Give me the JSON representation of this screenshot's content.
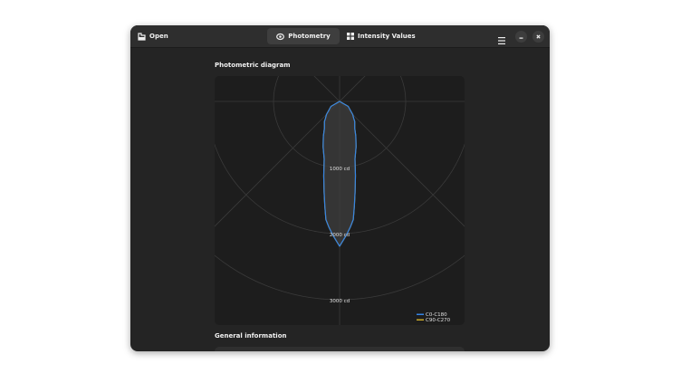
{
  "header": {
    "open_label": "Open",
    "tabs": [
      {
        "label": "Photometry",
        "icon": "eye-icon",
        "active": true
      },
      {
        "label": "Intensity Values",
        "icon": "grid-icon",
        "active": false
      }
    ],
    "menu_icon": "hamburger-icon",
    "minimize_icon": "minimize-icon",
    "close_icon": "close-icon"
  },
  "main": {
    "diagram_title": "Photometric diagram",
    "general_title": "General information"
  },
  "chart_data": {
    "type": "polar",
    "radial_ticks": [
      {
        "value": 1000,
        "label": "1000 cd"
      },
      {
        "value": 2000,
        "label": "2000 cd"
      },
      {
        "value": 3000,
        "label": "3000 cd"
      }
    ],
    "angle_unit": "deg",
    "series": [
      {
        "name": "C0-C180",
        "color": "#3584e4",
        "angles": [
          0,
          3,
          5,
          6.6,
          8,
          9.7,
          12,
          15,
          20,
          25,
          29.5,
          35,
          37,
          40,
          45,
          60,
          90
        ],
        "values": [
          2190,
          2020,
          1900,
          1800,
          1600,
          1390,
          1150,
          900,
          730,
          580,
          465,
          400,
          380,
          330,
          280,
          150,
          0
        ]
      },
      {
        "name": "C90-C270",
        "color": "#c8a82a",
        "angles": [
          0,
          3,
          5,
          6.6,
          8,
          9.7,
          12,
          15,
          20,
          25,
          29.5,
          35,
          37,
          40,
          45,
          60,
          90
        ],
        "values": [
          2190,
          2020,
          1900,
          1800,
          1600,
          1390,
          1150,
          900,
          730,
          580,
          465,
          400,
          380,
          330,
          280,
          150,
          0
        ]
      }
    ],
    "legend": "bottom-right"
  }
}
